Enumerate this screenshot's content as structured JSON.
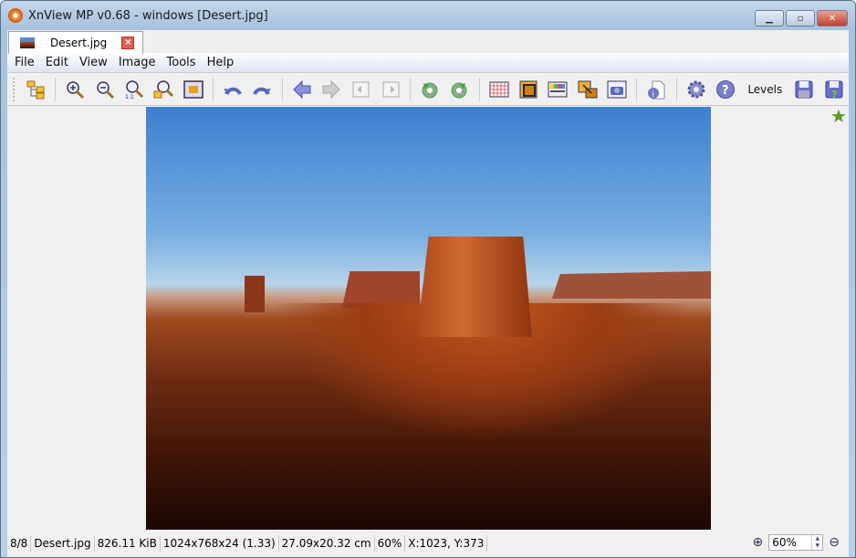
{
  "window": {
    "title": "XnView MP v0.68 - windows [Desert.jpg]",
    "minimize": "▁",
    "maximize": "▫",
    "close": "✕"
  },
  "tab": {
    "label": "Desert.jpg",
    "close": "×"
  },
  "menu": [
    {
      "label": "File"
    },
    {
      "label": "Edit"
    },
    {
      "label": "View"
    },
    {
      "label": "Image"
    },
    {
      "label": "Tools"
    },
    {
      "label": "Help"
    }
  ],
  "toolbar": {
    "levels_label": "Levels"
  },
  "status": {
    "index": "8/8",
    "filename": "Desert.jpg",
    "filesize": "826.11 KiB",
    "dimensions": "1024x768x24 (1.33)",
    "print_size": "27.09x20.32 cm",
    "zoom": "60%",
    "cursor": "X:1023, Y:373",
    "zoom_input": "60%"
  },
  "rating_star": "★"
}
